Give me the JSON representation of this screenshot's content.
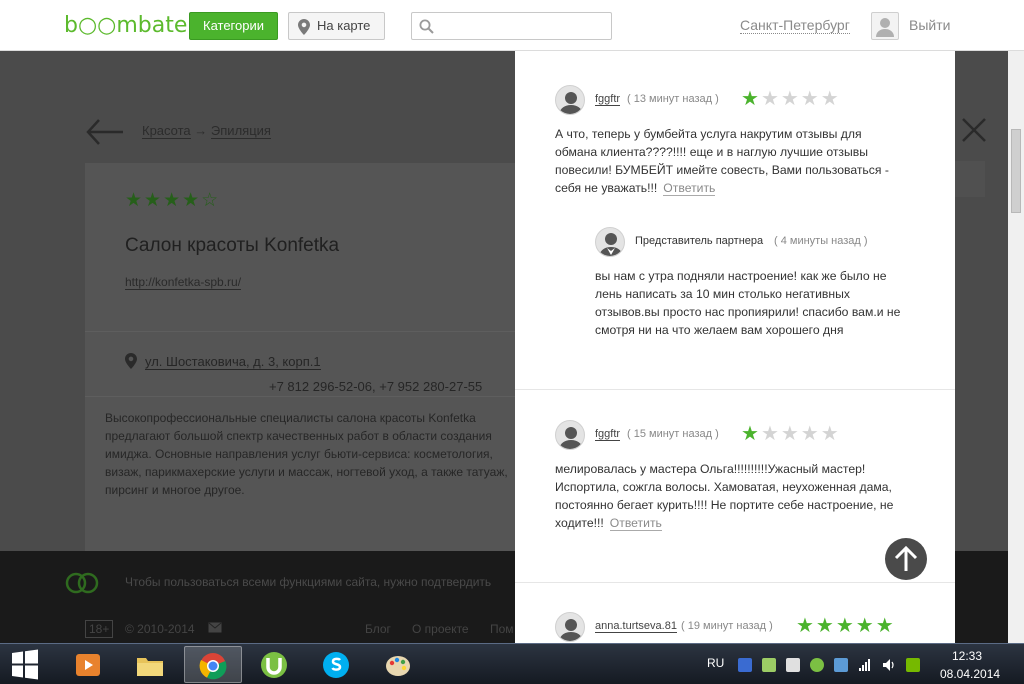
{
  "header": {
    "logo": "b○○mbate",
    "categories_btn": "Категории",
    "map_btn": "На карте",
    "search_placeholder": "",
    "city": "Санкт-Петербург",
    "logout": "Выйти"
  },
  "background_page": {
    "breadcrumb": [
      "Красота",
      "Эпиляция"
    ],
    "breadcrumb_sep": "→",
    "rating_stars": "★★★★☆",
    "salon_title": "Салон красоты Konfetka",
    "salon_link": "http://konfetka-spb.ru/",
    "address": "ул. Шостаковича, д. 3, корп.1",
    "phones": "+7 812 296-52-06, +7 952 280-27-55",
    "description": "Высокопрофессиональные специалисты салона красоты Konfetka предлагают большой спектр качественных работ в области создания имиджа. Основные направления услуг бьюти-сервиса: косметология, визаж, парикмахерские услуги и массаж, ногтевой уход, а также татуаж, пирсинг и многое другое.",
    "footer_notice": "Чтобы пользоваться всеми функциями сайта, нужно подтвердить",
    "footer_age": "18+",
    "footer_copyright": "© 2010-2014",
    "footer_links": [
      "Блог",
      "О проекте",
      "Пом"
    ]
  },
  "reviews": [
    {
      "user": "fggftr",
      "time": "( 13 минут назад )",
      "rating": 1,
      "text": "А что, теперь у бумбейта услуга накрутим отзывы для обмана клиента????!!!! еще и в наглую лучшие отзывы повесили! БУМБЕЙТ имейте совесть, Вами пользоваться - себя не уважать!!!",
      "reply_label": "Ответить",
      "partner_reply": {
        "name": "Представитель партнера",
        "time": "( 4 минуты назад )",
        "text": "вы нам с утра подняли настроение! как же было не лень написать за 10 мин столько негативных отзывов.вы просто нас пропиярили! спасибо вам.и не смотря ни на что желаем вам хорошего дня"
      }
    },
    {
      "user": "fggftr",
      "time": "( 15 минут назад )",
      "rating": 1,
      "text": "мелировалась у мастера Ольга!!!!!!!!!!Ужасный мастер! Испортила, сожгла волосы. Хамоватая, неухоженная дама, постоянно бегает курить!!!! Не портите себе настроение, не ходите!!!",
      "reply_label": "Ответить"
    },
    {
      "user": "anna.turtseva.81",
      "time": "( 19 минут назад )",
      "rating": 5
    }
  ],
  "stars_full": "★★★★★",
  "taskbar": {
    "lang": "RU",
    "time": "12:33",
    "date": "08.04.2014"
  },
  "colors": {
    "accent_green": "#4bb32d",
    "star_off": "#d4d4d4",
    "overlay": "#4a4a4a"
  }
}
